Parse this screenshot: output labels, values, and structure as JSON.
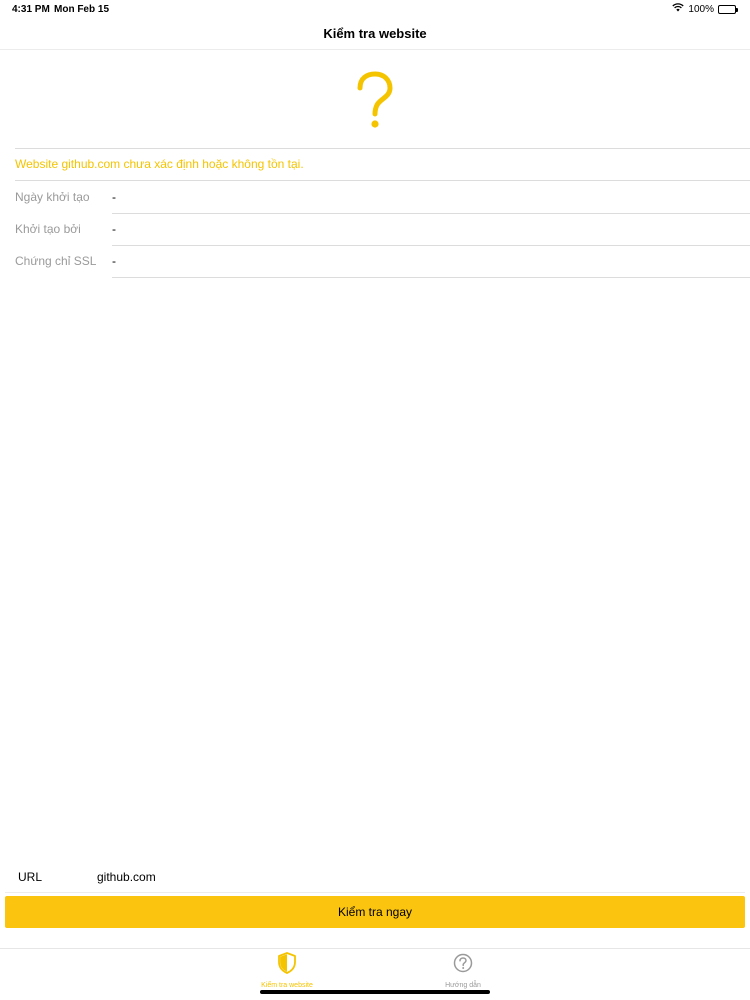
{
  "status_bar": {
    "time": "4:31 PM",
    "date": "Mon Feb 15",
    "battery": "100%"
  },
  "nav": {
    "title": "Kiểm tra website"
  },
  "result": {
    "icon": "question-mark-icon",
    "message": "Website github.com chưa xác định hoặc không tồn tại.",
    "rows": [
      {
        "label": "Ngày khởi tạo",
        "value": "-"
      },
      {
        "label": "Khởi tạo bởi",
        "value": "-"
      },
      {
        "label": "Chứng chỉ SSL",
        "value": "-"
      }
    ]
  },
  "form": {
    "url_label": "URL",
    "url_value": "github.com",
    "check_button": "Kiểm tra ngay"
  },
  "tabs": [
    {
      "label": "Kiểm tra website",
      "icon": "shield-icon",
      "active": true
    },
    {
      "label": "Hướng dẫn",
      "icon": "help-circle-icon",
      "active": false
    }
  ],
  "colors": {
    "accent": "#fbc40f",
    "message": "#f5c400",
    "label": "#9a9a9a"
  }
}
